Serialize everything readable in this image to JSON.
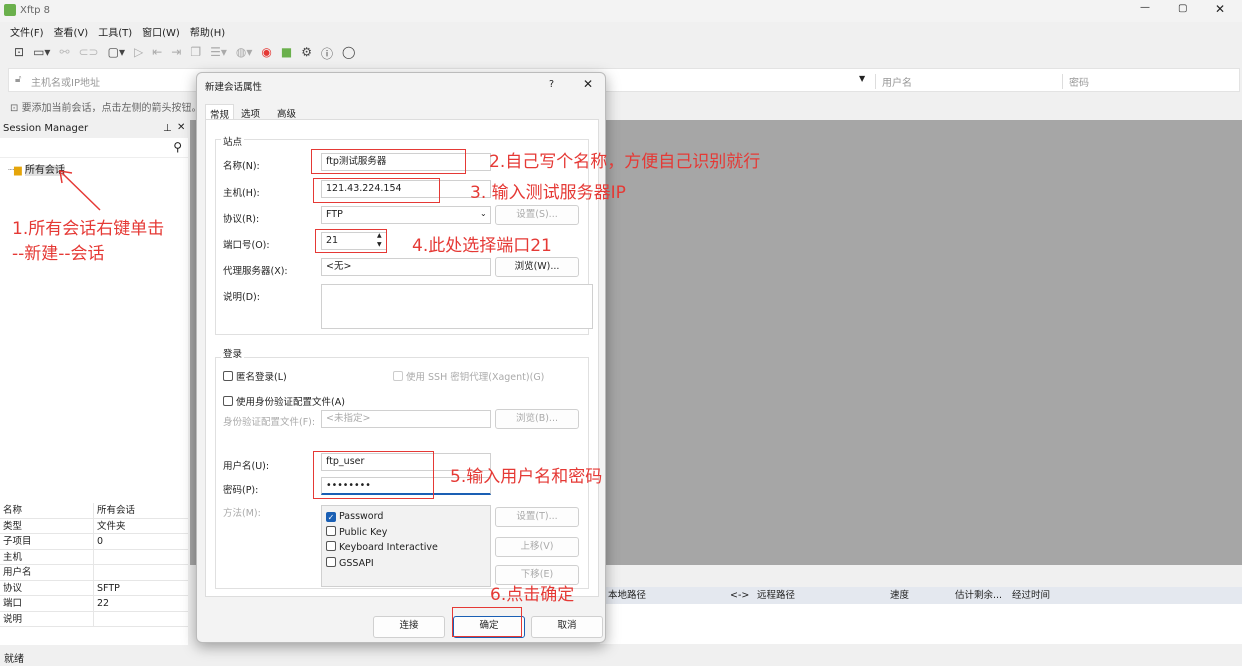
{
  "app": {
    "title": "Xftp 8"
  },
  "menu": [
    "文件(F)",
    "查看(V)",
    "工具(T)",
    "窗口(W)",
    "帮助(H)"
  ],
  "address": {
    "placeholder": "主机名或IP地址",
    "user_placeholder": "用户名",
    "password_placeholder": "密码"
  },
  "info": "要添加当前会话，点击左侧的箭头按钮。",
  "session_manager": {
    "title": "Session Manager",
    "tree_item": "所有会话"
  },
  "properties": [
    [
      "名称",
      "所有会话"
    ],
    [
      "类型",
      "文件夹"
    ],
    [
      "子项目",
      "0"
    ],
    [
      "主机",
      ""
    ],
    [
      "用户名",
      ""
    ],
    [
      "协议",
      "SFTP"
    ],
    [
      "端口",
      "22"
    ],
    [
      "说明",
      ""
    ]
  ],
  "transfer_headers": [
    "本地路径",
    "<->",
    "远程路径",
    "速度",
    "估计剩余...",
    "经过时间"
  ],
  "status": "就绪",
  "dialog": {
    "title": "新建会话属性",
    "help": "?",
    "tabs": [
      "常规",
      "选项",
      "高级"
    ],
    "site_group": "站点",
    "name_label": "名称(N):",
    "name_value": "ftp测试服务器",
    "host_label": "主机(H):",
    "host_value": "121.43.224.154",
    "protocol_label": "协议(R):",
    "protocol_value": "FTP",
    "settings_btn": "设置(S)...",
    "port_label": "端口号(O):",
    "port_value": "21",
    "proxy_label": "代理服务器(X):",
    "proxy_value": "<无>",
    "browse_btn": "浏览(W)...",
    "desc_label": "说明(D):",
    "login_group": "登录",
    "anon": "匿名登录(L)",
    "xagent": "使用 SSH 密钥代理(Xagent)(G)",
    "use_profile": "使用身份验证配置文件(A)",
    "profile_label": "身份验证配置文件(F):",
    "profile_value": "<未指定>",
    "profile_browse": "浏览(B)...",
    "user_label": "用户名(U):",
    "user_value": "ftp_user",
    "pass_label": "密码(P):",
    "pass_value": "••••••••",
    "method_label": "方法(M):",
    "methods": [
      {
        "label": "Password",
        "checked": true
      },
      {
        "label": "Public Key",
        "checked": false
      },
      {
        "label": "Keyboard Interactive",
        "checked": false
      },
      {
        "label": "GSSAPI",
        "checked": false
      }
    ],
    "method_settings": "设置(T)...",
    "move_up": "上移(V)",
    "move_down": "下移(E)",
    "connect": "连接",
    "ok": "确定",
    "cancel": "取消"
  },
  "annotations": [
    "1.所有会话右键单击\n--新建--会话",
    "2.自己写个名称，方便自己识别就行",
    "3. 输入测试服务器IP",
    "4.此处选择端口21",
    "5.输入用户名和密码",
    "6.点击确定"
  ]
}
